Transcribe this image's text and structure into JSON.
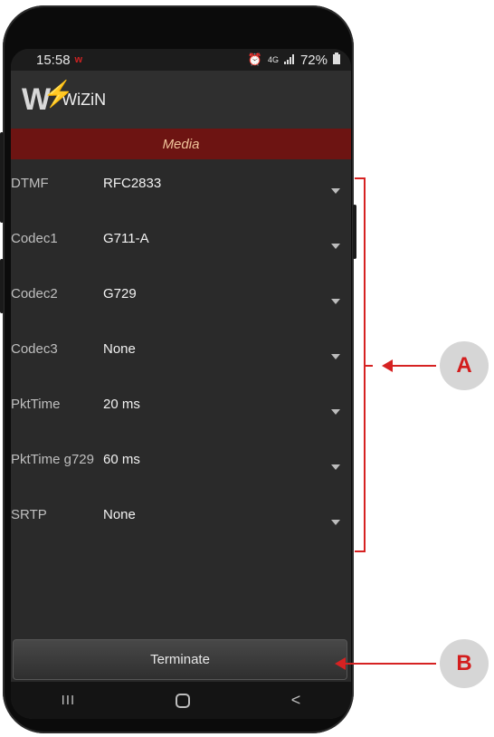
{
  "status_bar": {
    "time": "15:58",
    "app_badge_icon": "wizin-mini-icon",
    "alarm_icon": "alarm-icon",
    "network": "4G",
    "signal_icon": "signal-icon",
    "battery_percent": "72%",
    "battery_icon": "battery-icon"
  },
  "app_bar": {
    "logo_letter": "W",
    "title": "WiZiN"
  },
  "media_header": "Media",
  "settings": [
    {
      "label": "DTMF",
      "value": "RFC2833"
    },
    {
      "label": "Codec1",
      "value": "G711-A"
    },
    {
      "label": "Codec2",
      "value": "G729"
    },
    {
      "label": "Codec3",
      "value": "None"
    },
    {
      "label": "PktTime",
      "value": "20 ms"
    },
    {
      "label": "PktTime g729",
      "value": "60 ms"
    },
    {
      "label": "SRTP",
      "value": "None"
    }
  ],
  "terminate_button": "Terminate",
  "nav_bar": {
    "recents_glyph": "III",
    "back_glyph": "<"
  },
  "annotations": {
    "a_label": "A",
    "b_label": "B"
  },
  "colors": {
    "media_band": "#6d1412",
    "media_text": "#f0c39a",
    "annotation_red": "#d62222"
  }
}
